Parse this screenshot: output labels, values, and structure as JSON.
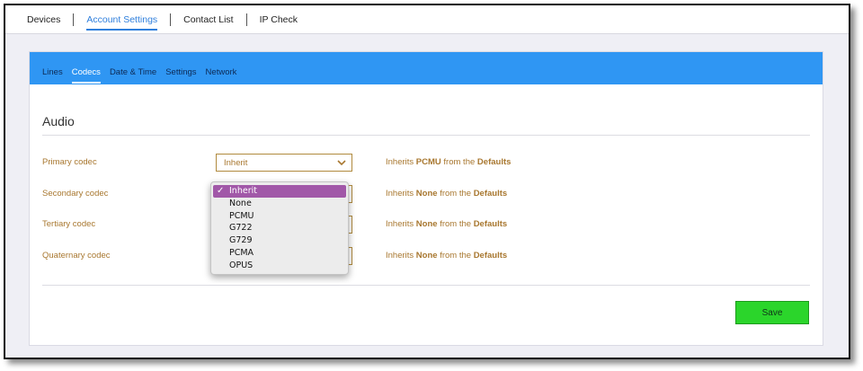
{
  "topnav": {
    "items": [
      {
        "label": "Devices",
        "active": false
      },
      {
        "label": "Account Settings",
        "active": true
      },
      {
        "label": "Contact List",
        "active": false
      },
      {
        "label": "IP Check",
        "active": false
      }
    ]
  },
  "subnav": {
    "tabs": [
      {
        "label": "Lines",
        "active": false
      },
      {
        "label": "Codecs",
        "active": true
      },
      {
        "label": "Date & Time",
        "active": false
      },
      {
        "label": "Settings",
        "active": false
      },
      {
        "label": "Network",
        "active": false
      }
    ]
  },
  "section": {
    "title": "Audio"
  },
  "rows": [
    {
      "label": "Primary codec",
      "value": "Inherit",
      "note_prefix": "Inherits",
      "note_value": "PCMU",
      "note_mid": "from the",
      "note_source": "Defaults"
    },
    {
      "label": "Secondary codec",
      "value": "",
      "note_prefix": "Inherits",
      "note_value": "None",
      "note_mid": "from the",
      "note_source": "Defaults"
    },
    {
      "label": "Tertiary codec",
      "value": "",
      "note_prefix": "Inherits",
      "note_value": "None",
      "note_mid": "from the",
      "note_source": "Defaults"
    },
    {
      "label": "Quaternary codec",
      "value": "",
      "note_prefix": "Inherits",
      "note_value": "None",
      "note_mid": "from the",
      "note_source": "Defaults"
    }
  ],
  "dropdown": {
    "check": "✓",
    "options": [
      "Inherit",
      "None",
      "PCMU",
      "G722",
      "G729",
      "PCMA",
      "OPUS"
    ],
    "selected_index": 0
  },
  "save": {
    "label": "Save"
  },
  "colors": {
    "accent_blue": "#2f96f3",
    "label_gold": "#a8772f",
    "save_green": "#2bd52b",
    "selected_purple": "#a158a8"
  }
}
